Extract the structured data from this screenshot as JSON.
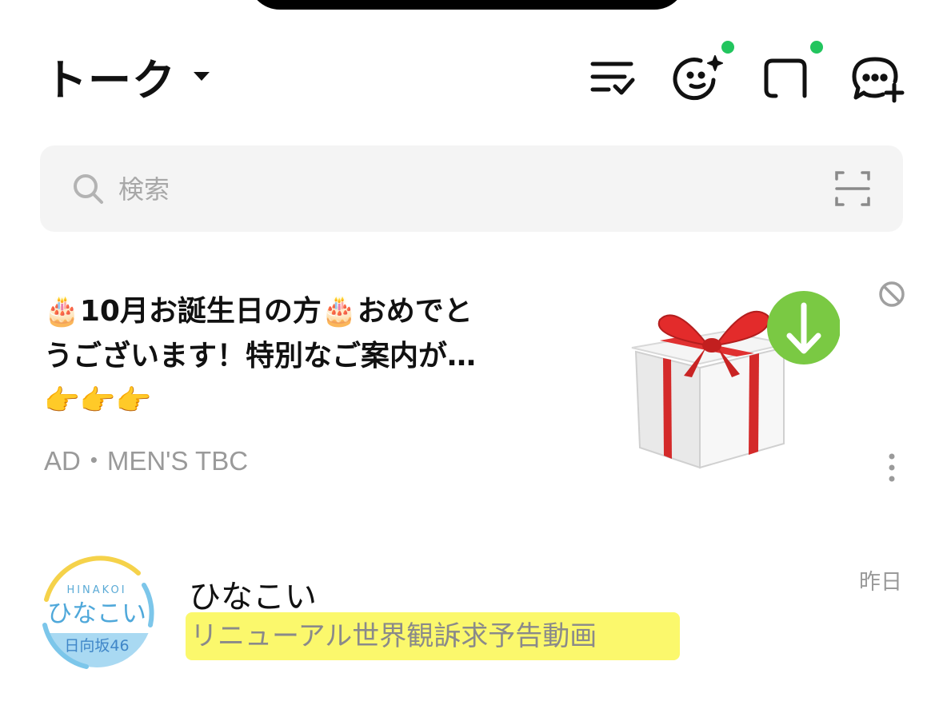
{
  "header": {
    "title": "トーク",
    "icons": [
      "list-check-icon",
      "face-sparkle-icon",
      "square-chat-icon",
      "chat-add-icon"
    ],
    "badge_color": "#22c55e"
  },
  "search": {
    "placeholder": "検索",
    "value": ""
  },
  "ad": {
    "text": "🎂10月お誕生日の方🎂おめでとうございます！特別なご案内が…👉👉👉",
    "meta": "AD・MEN'S TBC",
    "image": "gift-box-download",
    "accent": "#7ac943"
  },
  "chats": [
    {
      "name": "ひなこい",
      "time": "昨日",
      "preview": "リニューアル世界観訴求予告動画",
      "avatar": {
        "top_text": "HINAKOI",
        "main_text": "ひなこい",
        "bottom_text": "日向坂46"
      }
    }
  ]
}
